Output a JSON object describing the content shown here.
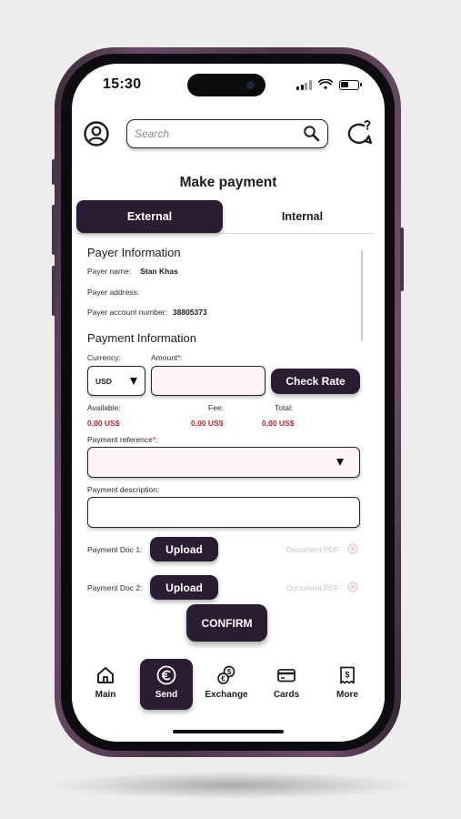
{
  "status_bar": {
    "time": "15:30"
  },
  "header": {
    "search_placeholder": "Search",
    "profile_icon": "user-circle-icon",
    "search_icon": "magnifier-icon",
    "chat_icon": "chat-bubble-question-icon"
  },
  "page": {
    "title": "Make payment"
  },
  "tabs": [
    {
      "label": "External",
      "active": true
    },
    {
      "label": "Internal",
      "active": false
    }
  ],
  "payer": {
    "section_title": "Payer Information",
    "name_label": "Payer name:",
    "name_value": "Stan Khas",
    "address_label": "Payer address:",
    "address_value": "",
    "account_label": "Payer account number:",
    "account_value": "38805373"
  },
  "payment": {
    "section_title": "Payment Information",
    "currency_label": "Currency:",
    "currency_value": "USD",
    "amount_label": "Amount",
    "required_mark": "*",
    "amount_suffix": ":",
    "amount_value": "",
    "check_rate_label": "Check Rate",
    "available_label": "Available:",
    "available_value": "0,00 US$",
    "fee_label": "Fee:",
    "fee_value": "0,00 US$",
    "total_label": "Total:",
    "total_value": "0,00 US$",
    "reference_label": "Payment reference",
    "reference_value": "",
    "description_label": "Payment description:",
    "description_value": "",
    "docs": [
      {
        "label": "Payment Doc 1:",
        "button": "Upload",
        "file": "Document.PDF"
      },
      {
        "label": "Payment Doc 2:",
        "button": "Upload",
        "file": "Document.PDF"
      }
    ],
    "confirm_label": "CONFIRM"
  },
  "bottom_nav": [
    {
      "label": "Main",
      "icon": "home-icon",
      "active": false
    },
    {
      "label": "Send",
      "icon": "euro-coin-icon",
      "active": true
    },
    {
      "label": "Exchange",
      "icon": "currency-exchange-icon",
      "active": false
    },
    {
      "label": "Cards",
      "icon": "card-icon",
      "active": false
    },
    {
      "label": "More",
      "icon": "receipt-icon",
      "active": false
    }
  ],
  "colors": {
    "brand_dark": "#2b1c34",
    "alert_red": "#c0202a",
    "field_tint": "#fff4f5",
    "frame": "#5b3f58"
  }
}
